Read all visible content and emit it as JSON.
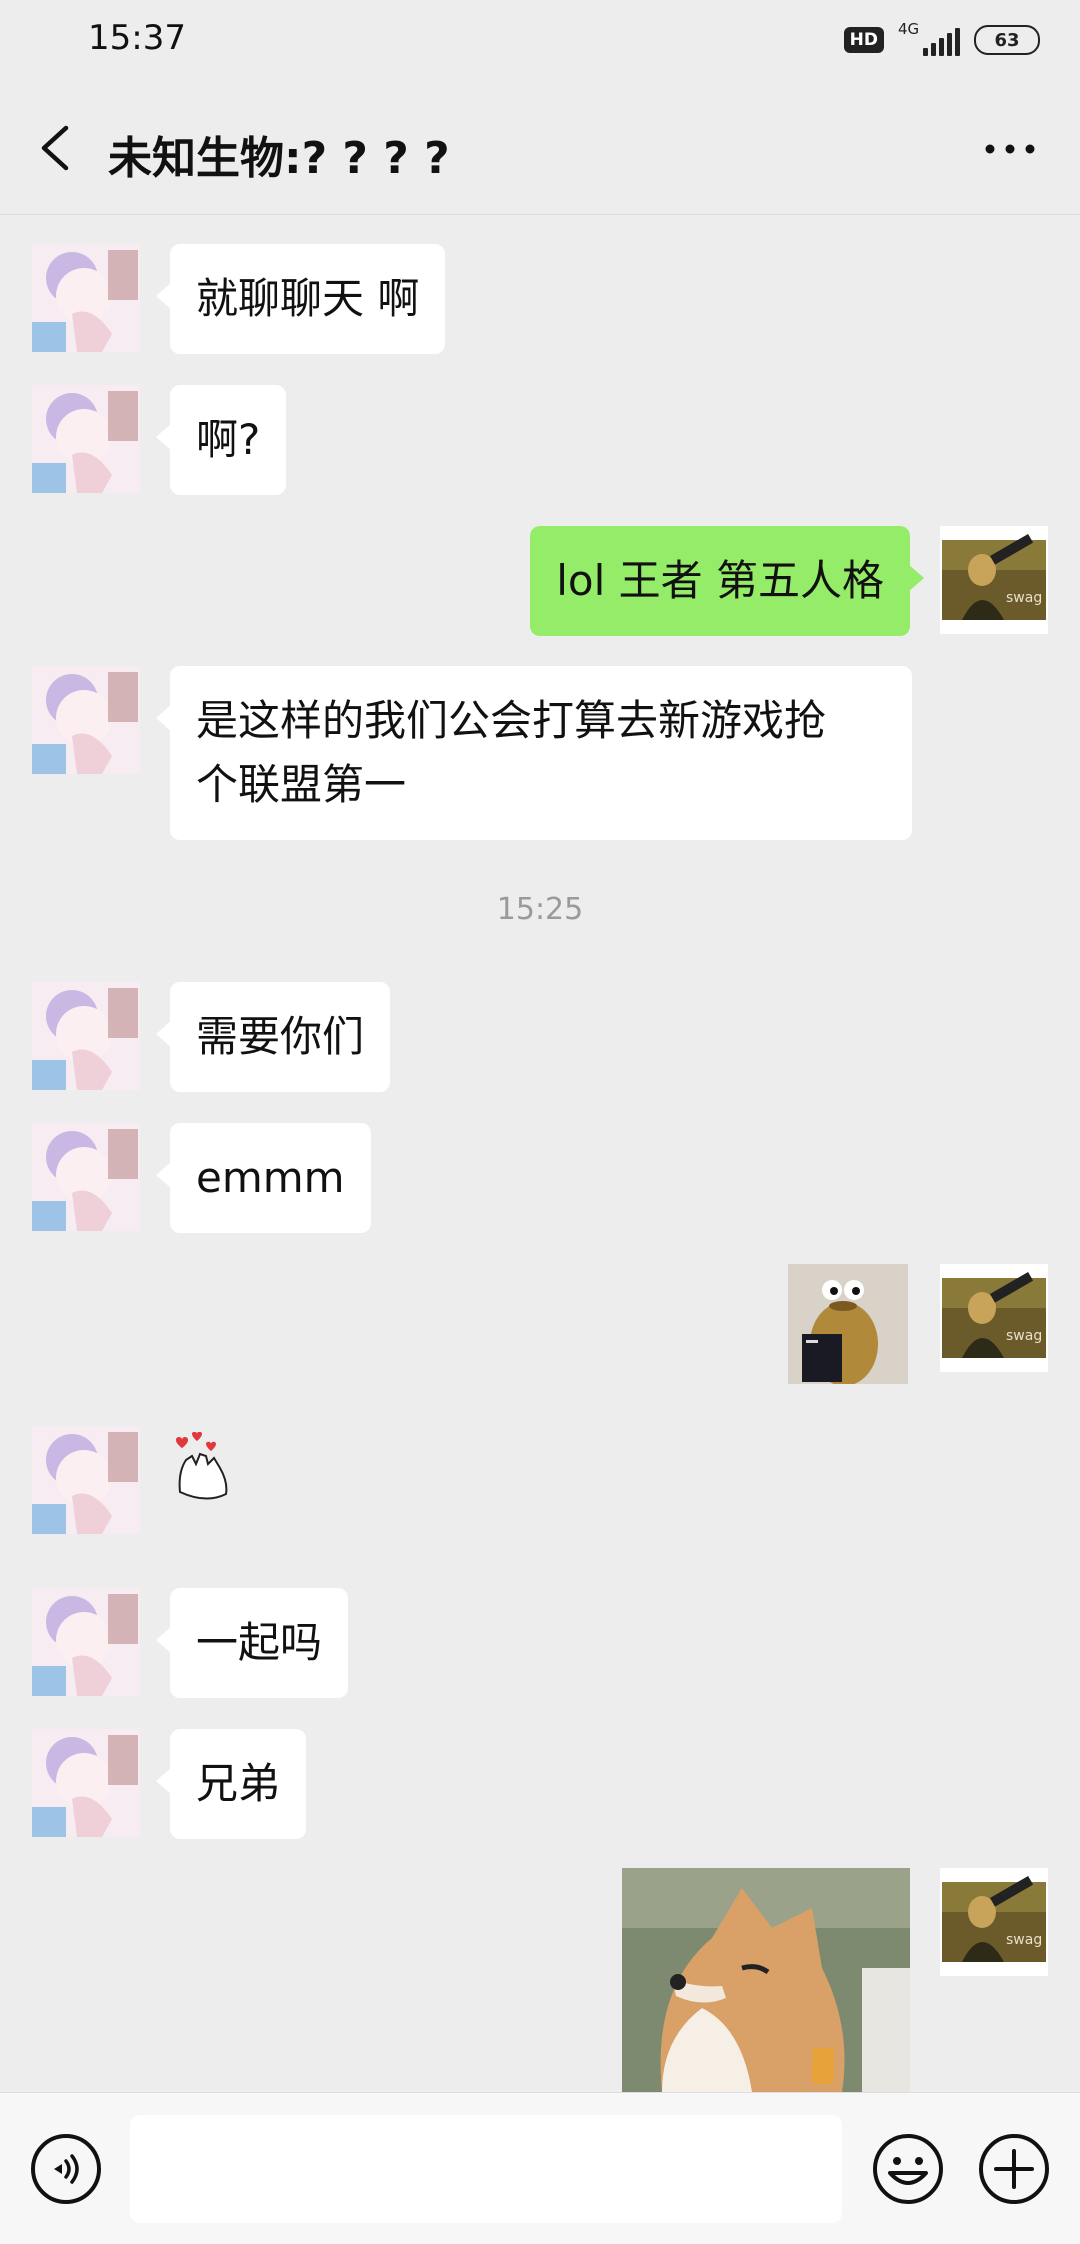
{
  "status_bar": {
    "time": "15:37",
    "hd_badge": "HD",
    "network": "4G",
    "battery": "63"
  },
  "header": {
    "title": "未知生物:? ? ? ?"
  },
  "messages": [
    {
      "side": "left",
      "type": "text",
      "text": "就聊聊天 啊"
    },
    {
      "side": "left",
      "type": "text",
      "text": "啊?"
    },
    {
      "side": "right",
      "type": "text",
      "text": "lol  王者 第五人格"
    },
    {
      "side": "left",
      "type": "text",
      "line1": "是这样的我们公会打算去新游戏抢",
      "line2": "个联盟第一"
    },
    {
      "type": "timestamp",
      "text": "15:25"
    },
    {
      "side": "left",
      "type": "text",
      "text": "需要你们"
    },
    {
      "side": "left",
      "type": "text",
      "text": "emmm"
    },
    {
      "side": "right",
      "type": "sticker",
      "icon": "bean-figure-sticker"
    },
    {
      "side": "left",
      "type": "sticker",
      "icon": "cheering-hands-sticker"
    },
    {
      "side": "left",
      "type": "text",
      "text": "一起吗"
    },
    {
      "side": "left",
      "type": "text",
      "text": "兄弟"
    },
    {
      "side": "right",
      "type": "sticker",
      "icon": "shiba-dog-sticker"
    }
  ],
  "my_avatar": {
    "caption": "swag"
  },
  "input_bar": {
    "placeholder": ""
  },
  "colors": {
    "background": "#ededed",
    "outgoing_bubble": "#95ec69",
    "incoming_bubble": "#ffffff"
  }
}
